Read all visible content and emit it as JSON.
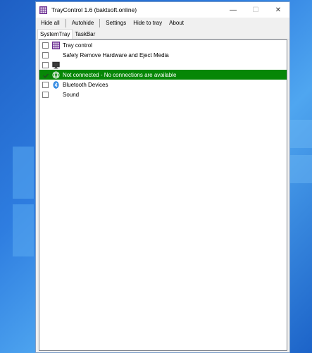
{
  "window": {
    "title": "TrayControl 1.6 (baktsoft.online)",
    "controls": {
      "minimize": "—",
      "maximize": "☐",
      "close": "✕"
    }
  },
  "menu": {
    "hide_all": "Hide all",
    "autohide": "Autohide",
    "settings": "Settings",
    "hide_to_tray": "Hide to tray",
    "about": "About"
  },
  "tabs": {
    "systemtray": "SystemTray",
    "taskbar": "TaskBar",
    "active": "SystemTray"
  },
  "tray_items": [
    {
      "label": "Tray control",
      "checked": false,
      "icon": "tray-control-icon"
    },
    {
      "label": "Safely Remove Hardware and Eject Media",
      "checked": false,
      "icon": "none"
    },
    {
      "label": "",
      "checked": false,
      "icon": "monitor-icon"
    },
    {
      "label": "Not connected - No connections are available",
      "checked": true,
      "icon": "network-globe-icon",
      "selected": true
    },
    {
      "label": "Bluetooth Devices",
      "checked": false,
      "icon": "bluetooth-icon"
    },
    {
      "label": "Sound",
      "checked": false,
      "icon": "none"
    }
  ],
  "colors": {
    "selection_background": "#068706",
    "selection_text": "#ffffff",
    "app_icon": "#6a2c91",
    "bluetooth": "#1f7fe0",
    "desktop": "#2e7de0"
  }
}
